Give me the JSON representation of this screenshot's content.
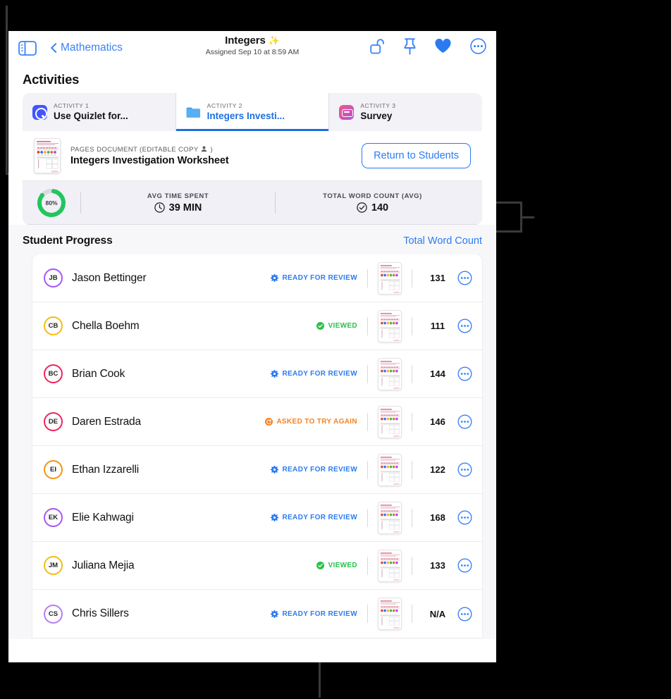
{
  "toolbar": {
    "sidebar_icon": "sidebar-icon",
    "back_label": "Mathematics",
    "title": "Integers",
    "title_sparkle": "✨",
    "subtitle": "Assigned Sep 10 at 8:59 AM",
    "icons": [
      {
        "name": "unlock-icon",
        "label": "Unlock"
      },
      {
        "name": "pin-icon",
        "label": "Pin"
      },
      {
        "name": "heart-icon",
        "label": "Favorite"
      },
      {
        "name": "more-icon",
        "label": "More"
      }
    ]
  },
  "activities": {
    "heading": "Activities",
    "tabs": [
      {
        "eyebrow": "ACTIVITY 1",
        "name": "Use Quizlet for...",
        "icon": "quizlet-icon",
        "active": false
      },
      {
        "eyebrow": "ACTIVITY 2",
        "name": "Integers Investi...",
        "icon": "folder-icon",
        "active": true
      },
      {
        "eyebrow": "ACTIVITY 3",
        "name": "Survey",
        "icon": "survey-icon",
        "active": false
      }
    ]
  },
  "document": {
    "kind": "PAGES DOCUMENT (EDITABLE COPY  )",
    "kind_prefix": "PAGES DOCUMENT (EDITABLE COPY",
    "kind_suffix": ")",
    "name": "Integers Investigation Worksheet",
    "action_label": "Return to Students"
  },
  "stats": {
    "ring_percent": "80%",
    "ring_value": 80,
    "ring_color": "#22c55e",
    "items": [
      {
        "label": "AVG TIME SPENT",
        "value": "39 MIN",
        "icon": "clock-icon"
      },
      {
        "label": "TOTAL WORD COUNT (AVG)",
        "value": "140",
        "icon": "check-badge-icon"
      }
    ]
  },
  "student_progress": {
    "title": "Student Progress",
    "link": "Total Word Count",
    "rows": [
      {
        "initials": "JB",
        "name": "Jason Bettinger",
        "status": "READY FOR REVIEW",
        "status_type": "review",
        "count": "131",
        "avatar_color": "#a855f7"
      },
      {
        "initials": "CB",
        "name": "Chella Boehm",
        "status": "VIEWED",
        "status_type": "viewed",
        "count": "111",
        "avatar_color": "#f5bc12"
      },
      {
        "initials": "BC",
        "name": "Brian Cook",
        "status": "READY FOR REVIEW",
        "status_type": "review",
        "count": "144",
        "avatar_color": "#f0245c"
      },
      {
        "initials": "DE",
        "name": "Daren Estrada",
        "status": "ASKED TO TRY AGAIN",
        "status_type": "retry",
        "count": "146",
        "avatar_color": "#f0245c"
      },
      {
        "initials": "EI",
        "name": "Ethan Izzarelli",
        "status": "READY FOR REVIEW",
        "status_type": "review",
        "count": "122",
        "avatar_color": "#f59214"
      },
      {
        "initials": "EK",
        "name": "Elie Kahwagi",
        "status": "READY FOR REVIEW",
        "status_type": "review",
        "count": "168",
        "avatar_color": "#a855f7"
      },
      {
        "initials": "JM",
        "name": "Juliana Mejia",
        "status": "VIEWED",
        "status_type": "viewed",
        "count": "133",
        "avatar_color": "#f5bc12"
      },
      {
        "initials": "CS",
        "name": "Chris Sillers",
        "status": "READY FOR REVIEW",
        "status_type": "review",
        "count": "N/A",
        "avatar_color": "#b57ef0"
      }
    ]
  },
  "colors": {
    "accent_blue": "#2b7bf0",
    "status_review": "#2b7bf0",
    "status_viewed": "#29c24a",
    "status_retry": "#f5821f",
    "ring_green": "#22c55e"
  }
}
